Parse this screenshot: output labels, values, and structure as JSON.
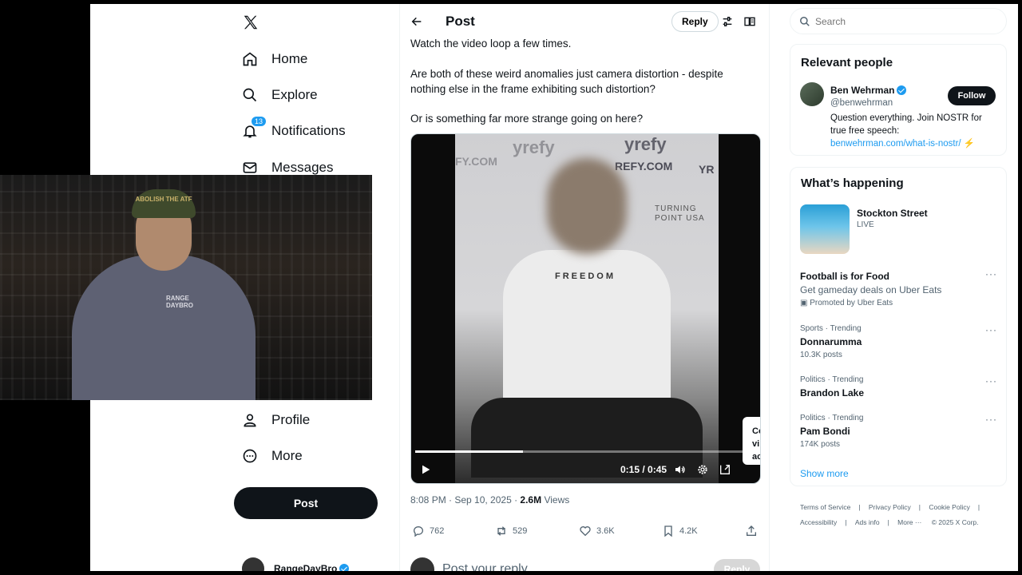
{
  "nav": {
    "home": "Home",
    "explore": "Explore",
    "notifications": "Notifications",
    "notifications_badge": "13",
    "messages": "Messages",
    "profile": "Profile",
    "more": "More",
    "post_button": "Post",
    "account_name": "RangeDayBro"
  },
  "cam": {
    "hat_text": "ABOLISH THE ATF",
    "shirt_text": "RANGE DAYBRO"
  },
  "header": {
    "title": "Post",
    "reply_label": "Reply"
  },
  "tweet": {
    "line1": "Watch the video loop a few times.",
    "line2": "Are both of these weird anomalies just camera distortion - despite nothing else in the frame exhibiting such distortion?",
    "line3": "Or is something far more strange going on here?",
    "timestamp": "8:08 PM · Sep 10, 2025",
    "views_count": "2.6M",
    "views_label": "Views"
  },
  "video": {
    "logo1": "yrefy",
    "logo1b": "FY.COM",
    "logo2": "yrefy",
    "logo3": "REFY.COM",
    "logo_yr": "YR",
    "tp_text": "TURNING POINT USA",
    "shirt_text": "FREEDOM",
    "time": "0:15 / 0:45",
    "progress": 0.33,
    "tooltip": "Co vi ac"
  },
  "actions": {
    "replies": "762",
    "reposts": "529",
    "likes": "3.6K",
    "bookmarks": "4.2K"
  },
  "reply_box": {
    "placeholder": "Post your reply",
    "button": "Reply"
  },
  "search": {
    "placeholder": "Search"
  },
  "relevant": {
    "title": "Relevant people",
    "name": "Ben Wehrman",
    "handle": "@benwehrman",
    "follow": "Follow",
    "bio": "Question everything. Join NOSTR for true free speech:",
    "link": "benwehrman.com/what-is-nostr/",
    "emoji": "⚡"
  },
  "happening": {
    "title": "What’s happening",
    "live_title": "Stockton Street",
    "live_sub": "LIVE",
    "promo_title": "Football is for Food",
    "promo_desc": "Get gameday deals on Uber Eats",
    "promo_by": "Promoted by Uber Eats",
    "t1_cat": "Sports · Trending",
    "t1_title": "Donnarumma",
    "t1_count": "10.3K posts",
    "t2_cat": "Politics · Trending",
    "t2_title": "Brandon Lake",
    "t3_cat": "Politics · Trending",
    "t3_title": "Pam Bondi",
    "t3_count": "174K posts",
    "show_more": "Show more"
  },
  "footer": {
    "terms": "Terms of Service",
    "privacy": "Privacy Policy",
    "cookie": "Cookie Policy",
    "accessibility": "Accessibility",
    "ads": "Ads info",
    "more": "More ···",
    "copyright": "© 2025 X Corp."
  },
  "colors": {
    "accent": "#1d9bf0",
    "text": "#0f1419",
    "muted": "#536471"
  }
}
